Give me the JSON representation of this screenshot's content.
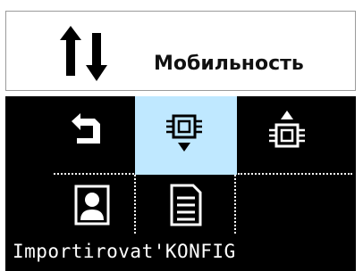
{
  "header": {
    "title": "Мобильность",
    "icon": "up-down-arrows-icon"
  },
  "menu": {
    "items": [
      {
        "icon": "back-arrow-icon",
        "selected": false
      },
      {
        "icon": "chip-import-icon",
        "selected": true
      },
      {
        "icon": "chip-export-icon",
        "selected": false
      },
      {
        "icon": "user-profile-icon",
        "selected": false
      },
      {
        "icon": "document-icon",
        "selected": false
      }
    ],
    "highlight_color": "#bfe8ff"
  },
  "status": {
    "label": "Importirovat'KONFIG"
  }
}
